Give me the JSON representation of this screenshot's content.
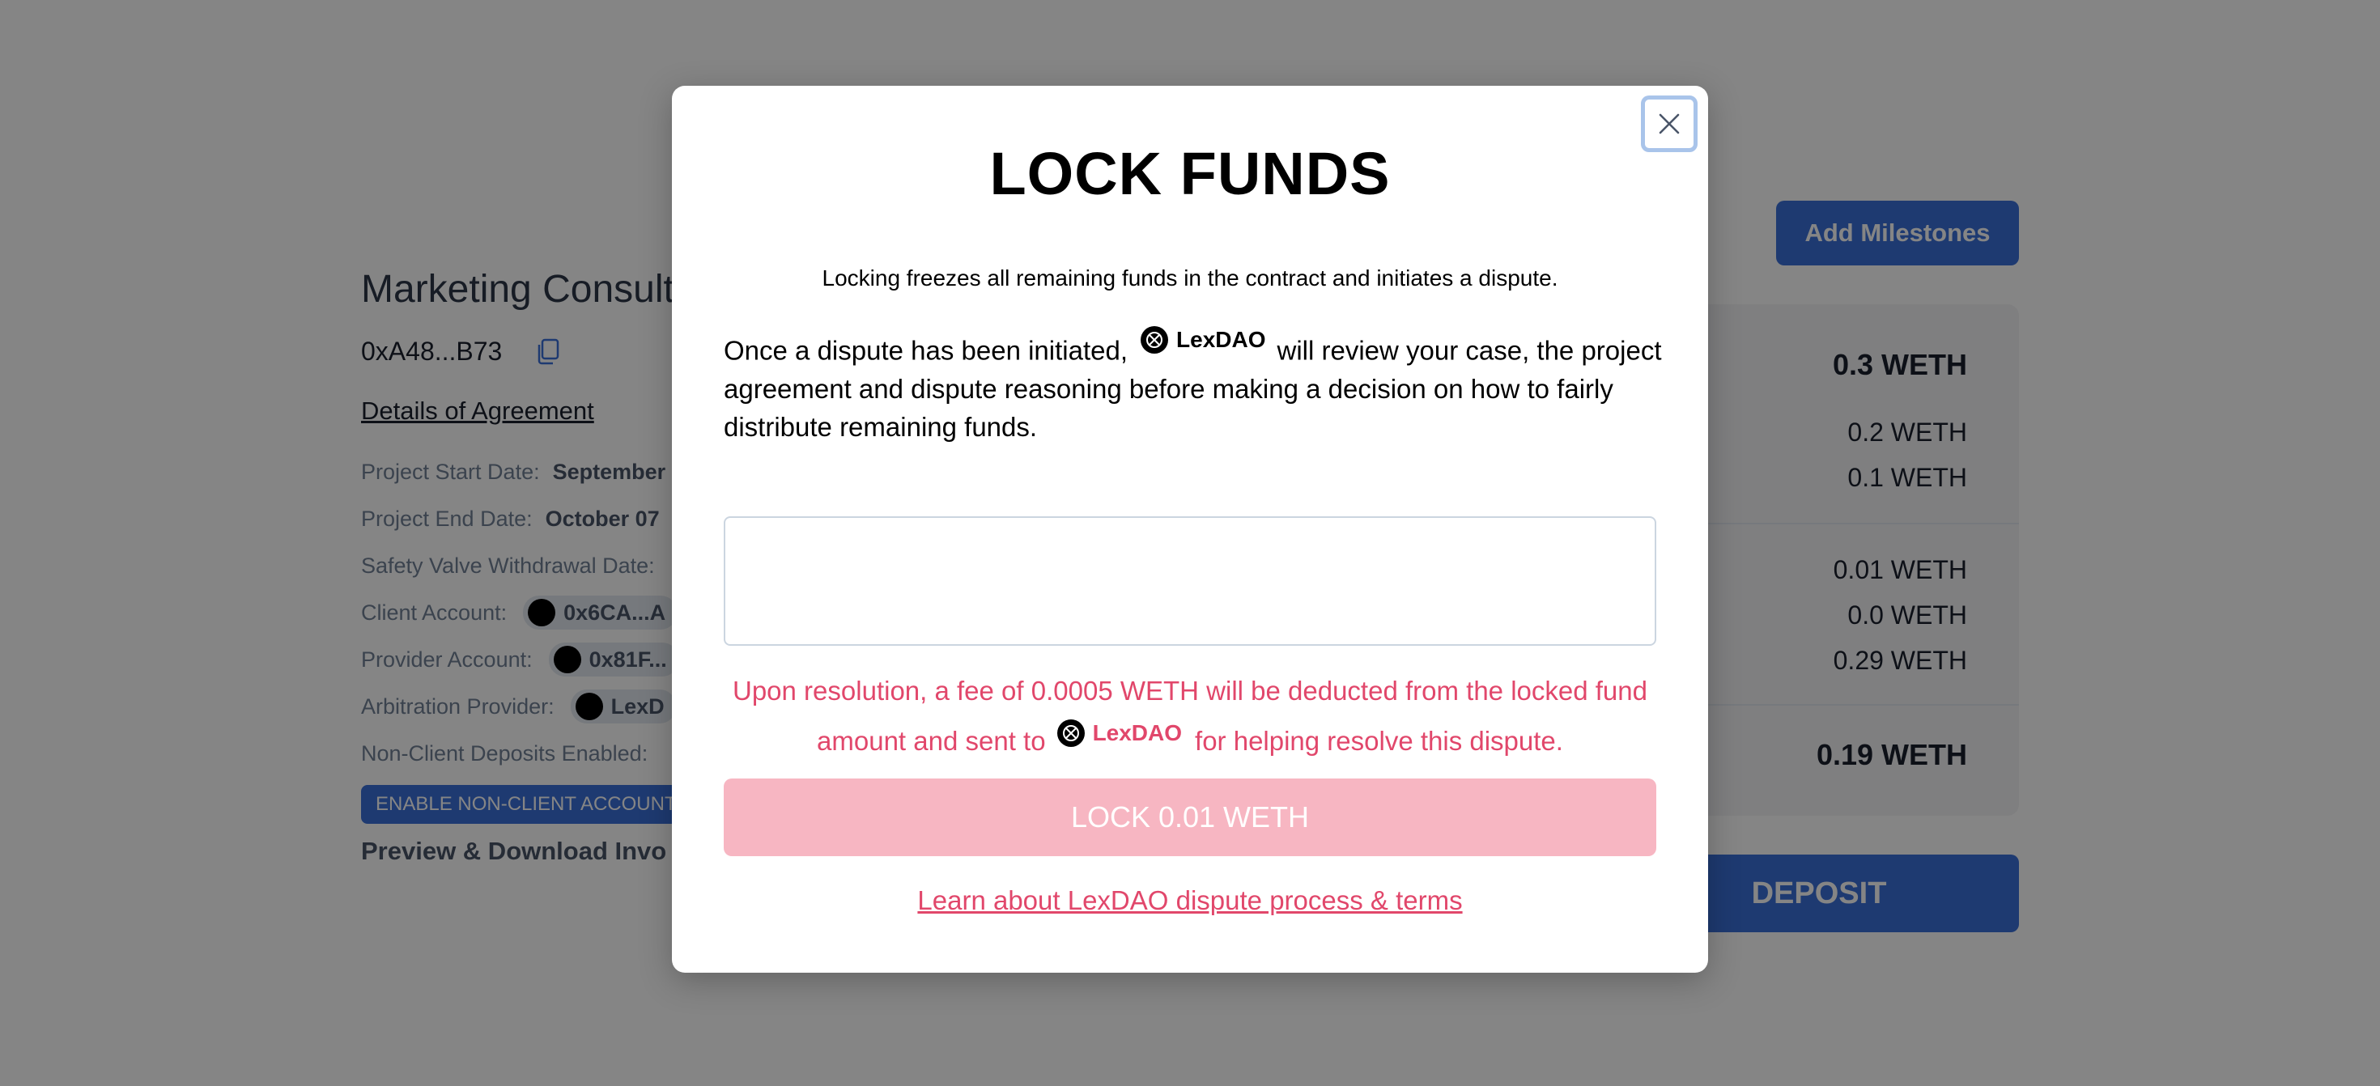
{
  "invoice": {
    "title": "Marketing Consult",
    "address": "0xA48...B73",
    "details_link": "Details of Agreement",
    "meta": [
      {
        "label": "Project Start Date:",
        "value": "September"
      },
      {
        "label": "Project End Date:",
        "value": "October 07"
      },
      {
        "label": "Safety Valve Withdrawal Date:",
        "value": ""
      },
      {
        "label": "Client Account:",
        "value": "0x6CA...A"
      },
      {
        "label": "Provider Account:",
        "value": "0x81F..."
      },
      {
        "label": "Arbitration Provider:",
        "value": "LexD"
      },
      {
        "label": "Non-Client Deposits Enabled:",
        "value": ""
      }
    ],
    "enable_button": "ENABLE NON-CLIENT ACCOUNT",
    "preview_link": "Preview & Download Invo"
  },
  "summary": {
    "add_milestones": "Add Milestones",
    "total": "0.3 WETH",
    "deposited": "0.2 WETH",
    "due": "0.1 WETH",
    "fee": "0.01 WETH",
    "released": "0.0 WETH",
    "remaining": "0.29 WETH",
    "balance": "0.19 WETH",
    "deposit_button": "DEPOSIT"
  },
  "modal": {
    "title": "LOCK FUNDS",
    "subtitle": "Locking freezes all remaining funds in the contract and initiates a dispute.",
    "body_before": "Once a dispute has been initiated,",
    "arbiter_name": "LexDAO",
    "body_after": "will review your case, the project agreement and dispute reasoning before making a decision on how to fairly distribute remaining funds.",
    "reason_placeholder": "",
    "fee_before": "Upon resolution, a fee of 0.0005 WETH will be deducted from the locked fund amount and sent to",
    "fee_after": "for helping resolve this dispute.",
    "lock_button": "LOCK 0.01 WETH",
    "learn_link": "Learn about LexDAO dispute process & terms"
  },
  "colors": {
    "accent_blue": "#3b6fd8",
    "danger_pink": "#e1476b",
    "lock_button_bg": "#f7b6c2"
  }
}
